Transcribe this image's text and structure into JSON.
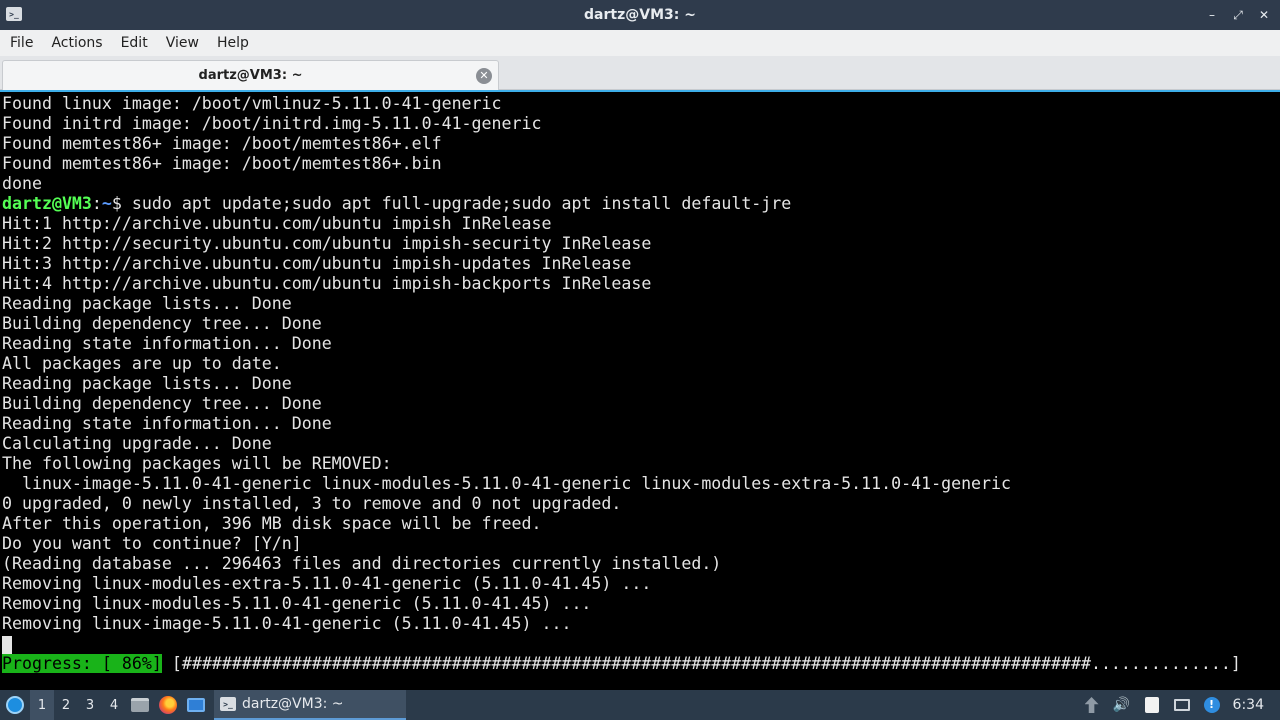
{
  "window": {
    "title": "dartz@VM3: ~",
    "app_icon": "terminal-icon",
    "buttons": {
      "minimize": "–",
      "restore": "⤢",
      "close": "✕"
    }
  },
  "menu": [
    "File",
    "Actions",
    "Edit",
    "View",
    "Help"
  ],
  "tab": {
    "label": "dartz@VM3: ~",
    "close_icon": "close-circle-icon"
  },
  "terminal": {
    "lines_before_prompt": [
      "Found linux image: /boot/vmlinuz-5.11.0-41-generic",
      "Found initrd image: /boot/initrd.img-5.11.0-41-generic",
      "Found memtest86+ image: /boot/memtest86+.elf",
      "Found memtest86+ image: /boot/memtest86+.bin",
      "done"
    ],
    "prompt": {
      "user_host": "dartz@VM3",
      "sep": ":",
      "path": "~",
      "symbol": "$",
      "command": " sudo apt update;sudo apt full-upgrade;sudo apt install default-jre"
    },
    "lines_after_prompt": [
      "Hit:1 http://archive.ubuntu.com/ubuntu impish InRelease",
      "Hit:2 http://security.ubuntu.com/ubuntu impish-security InRelease",
      "Hit:3 http://archive.ubuntu.com/ubuntu impish-updates InRelease",
      "Hit:4 http://archive.ubuntu.com/ubuntu impish-backports InRelease",
      "Reading package lists... Done",
      "Building dependency tree... Done",
      "Reading state information... Done",
      "All packages are up to date.",
      "Reading package lists... Done",
      "Building dependency tree... Done",
      "Reading state information... Done",
      "Calculating upgrade... Done",
      "The following packages will be REMOVED:",
      "  linux-image-5.11.0-41-generic linux-modules-5.11.0-41-generic linux-modules-extra-5.11.0-41-generic",
      "0 upgraded, 0 newly installed, 3 to remove and 0 not upgraded.",
      "After this operation, 396 MB disk space will be freed.",
      "Do you want to continue? [Y/n]",
      "(Reading database ... 296463 files and directories currently installed.)",
      "Removing linux-modules-extra-5.11.0-41-generic (5.11.0-41.45) ...",
      "Removing linux-modules-5.11.0-41-generic (5.11.0-41.45) ...",
      "Removing linux-image-5.11.0-41-generic (5.11.0-41.45) ..."
    ],
    "progress": {
      "label": "Progress: [ 86%]",
      "bar": " [###########################################################################################..............]"
    },
    "accent_color": "#3daee9",
    "prompt_user_color": "#54ff54",
    "prompt_path_color": "#5c9cff",
    "progress_label_color": "#19b319"
  },
  "taskbar": {
    "start_icon": "start-menu-icon",
    "desktops": [
      "1",
      "2",
      "3",
      "4"
    ],
    "active_desktop": "1",
    "launchers": [
      "file-manager-icon",
      "firefox-icon",
      "show-desktop-icon"
    ],
    "task": {
      "icon": "terminal-icon",
      "label": "dartz@VM3: ~"
    },
    "tray": [
      "removable-media-icon",
      "volume-icon",
      "clipboard-icon",
      "display-icon",
      "update-notifier-icon"
    ],
    "clock": "6:34"
  }
}
